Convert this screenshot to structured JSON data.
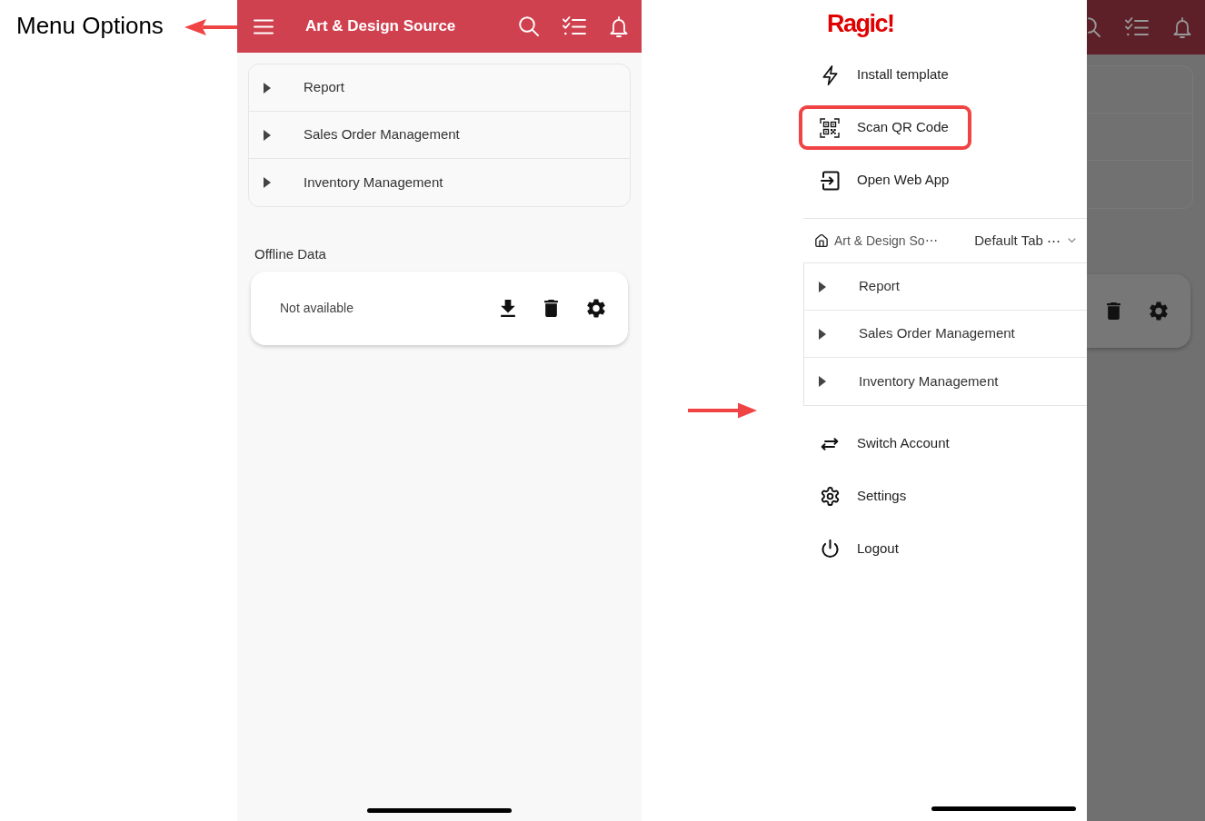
{
  "annotation": {
    "label": "Menu Options"
  },
  "app": {
    "title": "Art & Design Source",
    "tree": [
      {
        "label": "Report",
        "expanded": false
      },
      {
        "label": "Sales Order Management",
        "expanded": false
      },
      {
        "label": "Inventory Management",
        "expanded": false
      }
    ],
    "offline": {
      "title": "Offline Data",
      "status": "Not available"
    }
  },
  "drawer": {
    "logo": "Ragic!",
    "top_items": [
      {
        "label": "Install template",
        "highlighted": false
      },
      {
        "label": "Scan QR Code",
        "highlighted": true
      },
      {
        "label": "Open Web App",
        "highlighted": false
      }
    ],
    "breadcrumb": {
      "account": "Art & Design So⋯",
      "tab": "Default Tab ⋯"
    },
    "tree": [
      {
        "label": "Report",
        "expanded": false
      },
      {
        "label": "Sales Order Management",
        "expanded": false
      },
      {
        "label": "Inventory Management",
        "expanded": false
      }
    ],
    "bottom_items": [
      {
        "label": "Switch Account"
      },
      {
        "label": "Settings"
      },
      {
        "label": "Logout"
      }
    ]
  }
}
